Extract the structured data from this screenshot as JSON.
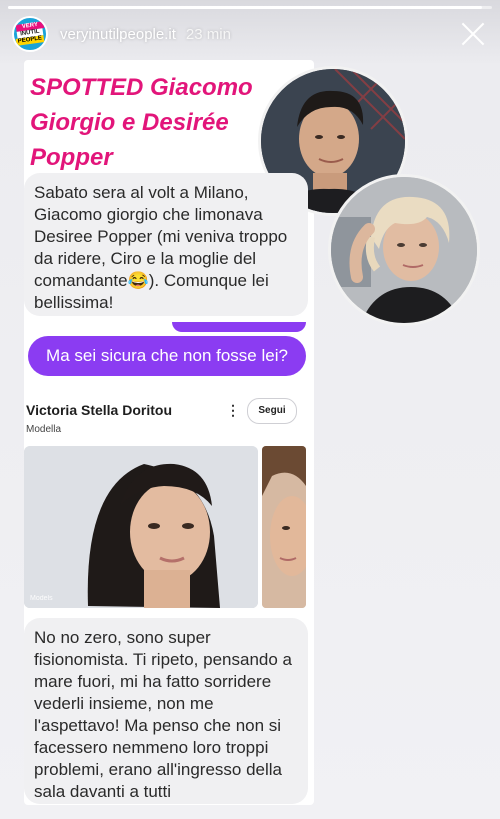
{
  "story": {
    "account": "veryinutilpeople.it",
    "time": "23 min",
    "progress": 0.98,
    "avatar_logo": [
      "VERY",
      "INUTIL",
      "PEOPLE"
    ]
  },
  "post": {
    "headline": "SPOTTED Giacomo Giorgio e Desirée Popper",
    "message1": "Sabato sera al volt a Milano, Giacomo giorgio che limonava Desiree Popper (mi veniva troppo da ridere, Ciro e la moglie del comandante😂). Comunque lei bellissima!",
    "reply": "Ma sei sicura che non fosse lei?",
    "profile": {
      "name": "Victoria Stella Doritou",
      "role": "Modella",
      "follow_label": "Segui",
      "more_icon": "⋮",
      "watermark": "Models"
    },
    "message2": "No no zero, sono super fisionomista. Ti ripeto, pensando a mare fuori, mi ha fatto sorridere vederli insieme, non me l'aspettavo! Ma penso che non si facessero nemmeno loro troppi problemi, erano all'ingresso della sala davanti a tutti"
  },
  "colors": {
    "headline": "#e2157a",
    "reply_bubble": "#8b3cf2",
    "received_bubble": "#f0f0f2"
  }
}
